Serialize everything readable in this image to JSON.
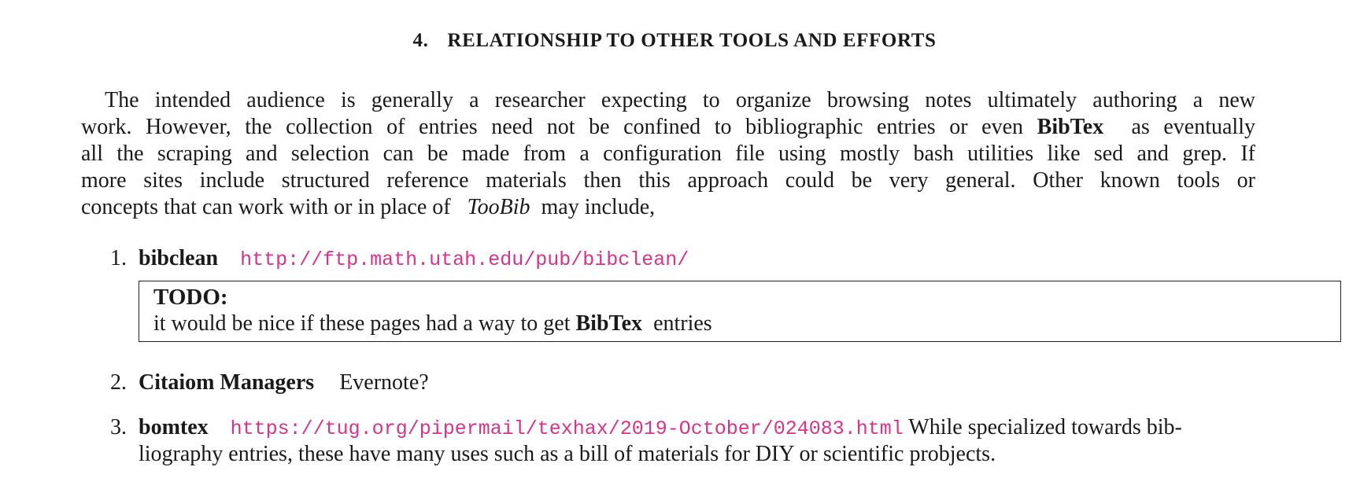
{
  "section": {
    "number": "4.",
    "title": "RELATIONSHIP TO OTHER TOOLS AND EFFORTS"
  },
  "intro": {
    "line1": "The intended audience is generally a researcher expecting to organize browsing notes ultimately authoring a new",
    "line2_a": "work. However, the collection of entries need not be confined to bibliographic entries or even",
    "line2_bold": "BibTex",
    "line2_b": "as eventually",
    "line3": "all the scraping and selection can be made from a configuration file using mostly bash utilities like sed and grep. If",
    "line4": "more sites include structured reference materials then this approach could be very general. Other known tools or",
    "line5_a": "concepts that can work with or in place of",
    "line5_italic": "TooBib",
    "line5_b": "may include,"
  },
  "items": [
    {
      "number": "1.",
      "title": "bibclean",
      "link": "http://ftp.math.utah.edu/pub/bibclean/"
    },
    {
      "number": "2.",
      "title": "Citaiom Managers",
      "text": "Evernote?"
    },
    {
      "number": "3.",
      "title": "bomtex",
      "link": "https://tug.org/pipermail/texhax/2019-October/024083.html",
      "text_a": "While specialized towards bib-",
      "text_b": "liography entries, these have many uses such as a bill of materials for DIY or scientific probjects."
    }
  ],
  "todo": {
    "heading": "TODO:",
    "text_a": "it would be nice if these pages had a way to get",
    "text_bold": "BibTex",
    "text_b": "entries"
  },
  "colors": {
    "link": "#d6338a",
    "text": "#1a1a1a",
    "border": "#222222"
  }
}
